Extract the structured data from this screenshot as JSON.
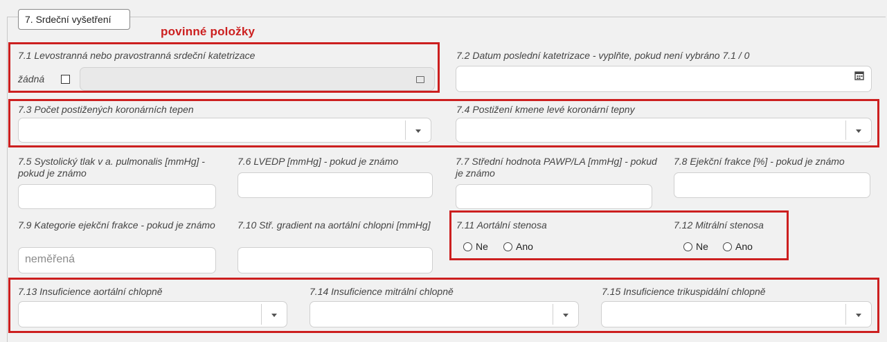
{
  "section": {
    "legend": "7. Srdeční vyšetření",
    "required_note": "povinné položky"
  },
  "fields": {
    "f7_1": {
      "label": "7.1 Levostranná nebo pravostranná srdeční katetrizace",
      "none_label": "žádná",
      "none_checked": false
    },
    "f7_2": {
      "label": "7.2 Datum poslední katetrizace - vyplňte, pokud není vybráno 7.1 / 0"
    },
    "f7_3": {
      "label": "7.3 Počet postižených koronárních tepen"
    },
    "f7_4": {
      "label": "7.4 Postižení kmene levé koronární tepny"
    },
    "f7_5": {
      "label": "7.5 Systolický tlak v a. pulmonalis [mmHg] - pokud je známo"
    },
    "f7_6": {
      "label": "7.6 LVEDP [mmHg] - pokud je známo"
    },
    "f7_7": {
      "label": "7.7 Střední hodnota PAWP/LA [mmHg] - pokud je známo"
    },
    "f7_8": {
      "label": "7.8 Ejekční frakce [%] - pokud je známo"
    },
    "f7_9": {
      "label": "7.9 Kategorie ejekční frakce - pokud je známo",
      "value": "neměřená"
    },
    "f7_10": {
      "label": "7.10 Stř. gradient na aortální chlopni [mmHg]"
    },
    "f7_11": {
      "label": "7.11 Aortální stenosa",
      "options": [
        "Ne",
        "Ano"
      ]
    },
    "f7_12": {
      "label": "7.12 Mitrální stenosa",
      "options": [
        "Ne",
        "Ano"
      ]
    },
    "f7_13": {
      "label": "7.13 Insuficience aortální chlopně"
    },
    "f7_14": {
      "label": "7.14 Insuficience mitrální chlopně"
    },
    "f7_15": {
      "label": "7.15 Insuficience trikuspidální chlopně"
    }
  },
  "colors": {
    "required_red": "#cc1f1f",
    "background": "#f1f1f1"
  }
}
